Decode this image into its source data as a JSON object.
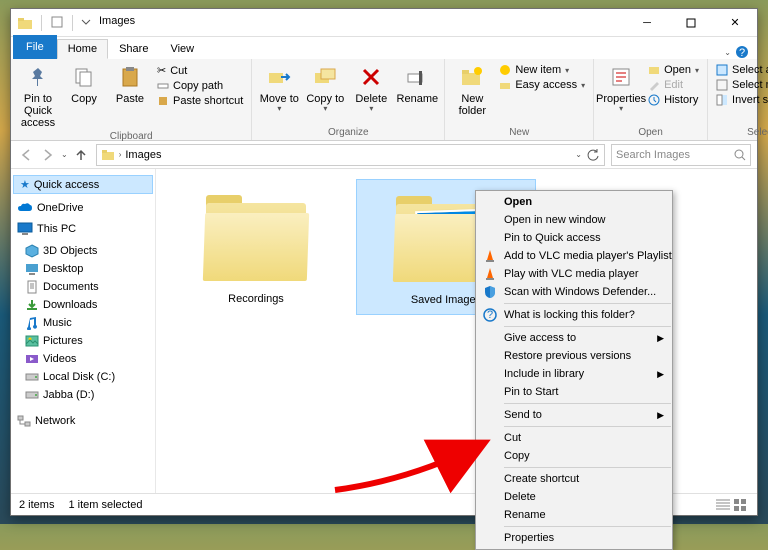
{
  "title": "Images",
  "tabs": {
    "file": "File",
    "home": "Home",
    "share": "Share",
    "view": "View"
  },
  "ribbon": {
    "clipboard": {
      "pin": "Pin to Quick access",
      "copy": "Copy",
      "paste": "Paste",
      "cut": "Cut",
      "copypath": "Copy path",
      "pasteshortcut": "Paste shortcut",
      "label": "Clipboard"
    },
    "organize": {
      "moveto": "Move to",
      "copyto": "Copy to",
      "delete": "Delete",
      "rename": "Rename",
      "label": "Organize"
    },
    "new": {
      "newfolder": "New folder",
      "newitem": "New item",
      "easyaccess": "Easy access",
      "label": "New"
    },
    "open": {
      "properties": "Properties",
      "open": "Open",
      "edit": "Edit",
      "history": "History",
      "label": "Open"
    },
    "select": {
      "selectall": "Select all",
      "selectnone": "Select none",
      "invert": "Invert selection",
      "label": "Select"
    }
  },
  "breadcrumb": "Images",
  "search_placeholder": "Search Images",
  "sidebar": {
    "quick": "Quick access",
    "onedrive": "OneDrive",
    "thispc": "This PC",
    "items": [
      "3D Objects",
      "Desktop",
      "Documents",
      "Downloads",
      "Music",
      "Pictures",
      "Videos",
      "Local Disk (C:)",
      "Jabba (D:)"
    ],
    "network": "Network"
  },
  "folders": [
    {
      "name": "Recordings",
      "selected": false
    },
    {
      "name": "Saved Images",
      "selected": true
    }
  ],
  "context_menu": [
    {
      "label": "Open",
      "bold": true
    },
    {
      "label": "Open in new window"
    },
    {
      "label": "Pin to Quick access"
    },
    {
      "label": "Add to VLC media player's Playlist",
      "icon": "vlc"
    },
    {
      "label": "Play with VLC media player",
      "icon": "vlc"
    },
    {
      "label": "Scan with Windows Defender...",
      "icon": "shield"
    },
    {
      "sep": true
    },
    {
      "label": "What is locking this folder?",
      "icon": "lock"
    },
    {
      "sep": true
    },
    {
      "label": "Give access to",
      "submenu": true
    },
    {
      "label": "Restore previous versions"
    },
    {
      "label": "Include in library",
      "submenu": true
    },
    {
      "label": "Pin to Start"
    },
    {
      "sep": true
    },
    {
      "label": "Send to",
      "submenu": true
    },
    {
      "sep": true
    },
    {
      "label": "Cut"
    },
    {
      "label": "Copy"
    },
    {
      "sep": true
    },
    {
      "label": "Create shortcut"
    },
    {
      "label": "Delete"
    },
    {
      "label": "Rename"
    },
    {
      "sep": true
    },
    {
      "label": "Properties"
    }
  ],
  "status": {
    "items": "2 items",
    "selected": "1 item selected"
  }
}
